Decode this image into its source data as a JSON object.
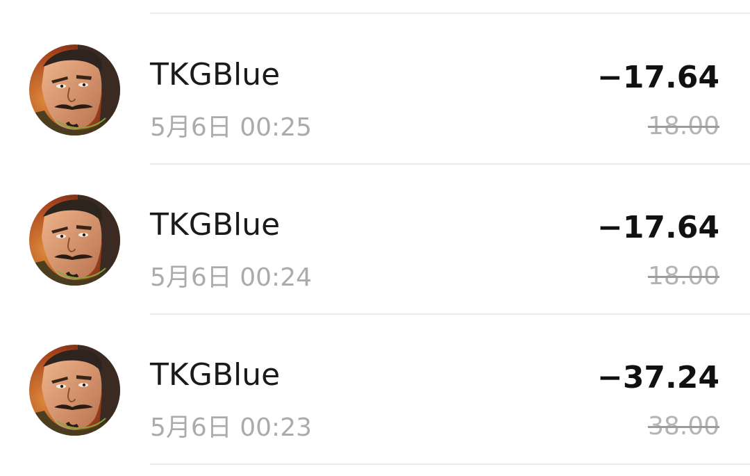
{
  "transactions": [
    {
      "name": "TKGBlue",
      "time": "5月6日 00:25",
      "amount": "−17.64",
      "original": "18.00",
      "avatar_icon": "character-portrait-avatar"
    },
    {
      "name": "TKGBlue",
      "time": "5月6日 00:24",
      "amount": "−17.64",
      "original": "18.00",
      "avatar_icon": "character-portrait-avatar"
    },
    {
      "name": "TKGBlue",
      "time": "5月6日 00:23",
      "amount": "−37.24",
      "original": "38.00",
      "avatar_icon": "character-portrait-avatar"
    }
  ],
  "colors": {
    "name_text": "#1a1a1a",
    "time_text": "#ababab",
    "amount_text": "#111111",
    "original_text": "#b4b4b4",
    "divider": "#ececec"
  }
}
